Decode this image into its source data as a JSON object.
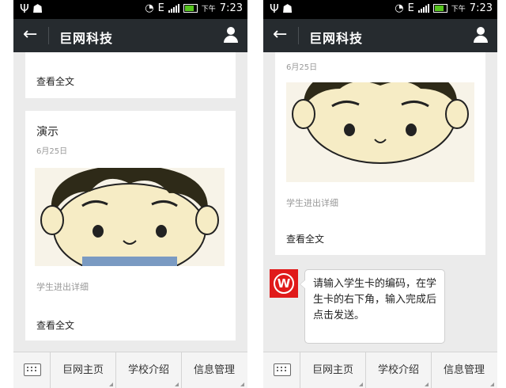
{
  "status_bar": {
    "ampm": "下午",
    "time": "7:23",
    "network": "E"
  },
  "header": {
    "title": "巨网科技"
  },
  "left": {
    "card_top": {
      "more": "查看全文"
    },
    "card_main": {
      "title": "演示",
      "date": "6月25日",
      "desc": "学生进出详细",
      "more": "查看全文"
    }
  },
  "right": {
    "card": {
      "date": "6月25日",
      "desc": "学生进出详细",
      "more": "查看全文"
    },
    "message": {
      "text": "请输入学生卡的编码，在学生卡的右下角，输入完成后点击发送。",
      "avatar_letter": "W"
    }
  },
  "toolbar": {
    "menus": [
      "巨网主页",
      "学校介绍",
      "信息管理"
    ]
  },
  "icons": [
    "usb-icon",
    "android-icon",
    "wifi-icon",
    "signal-icon",
    "battery-icon",
    "back-arrow-icon",
    "user-icon",
    "keyboard-icon"
  ],
  "colors": {
    "titlebar": "#262b2f",
    "background": "#ebebeb",
    "avatar": "#e01a1a",
    "battery": "#57c51f"
  }
}
